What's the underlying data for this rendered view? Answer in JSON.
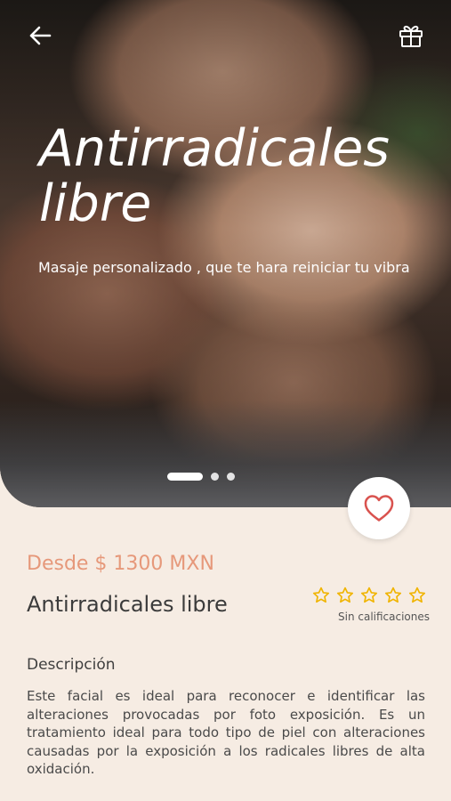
{
  "hero": {
    "title": "Antirradicales libre",
    "subtitle": "Masaje personalizado , que te hara reiniciar tu vibra",
    "carousel": {
      "total_slides": 3,
      "active_slide": 1
    }
  },
  "header": {
    "back_icon": "arrow-left-icon",
    "gift_icon": "gift-icon"
  },
  "favorite": {
    "icon": "heart-icon",
    "color": "#d9534f"
  },
  "product": {
    "price": "Desde $ 1300 MXN",
    "name": "Antirradicales libre",
    "rating": {
      "value": 0,
      "max": 5,
      "label": "Sin calificaciones",
      "star_color": "#f0b400"
    }
  },
  "description": {
    "label": "Descripción",
    "text": "Este facial es ideal para reconocer e identificar las alteraciones provocadas por foto exposición. Es un tratamiento ideal para todo tipo de piel con alteraciones causadas por la exposición a los radicales libres de alta oxidación."
  },
  "colors": {
    "accent": "#e6987a",
    "background": "#f6ece3"
  }
}
